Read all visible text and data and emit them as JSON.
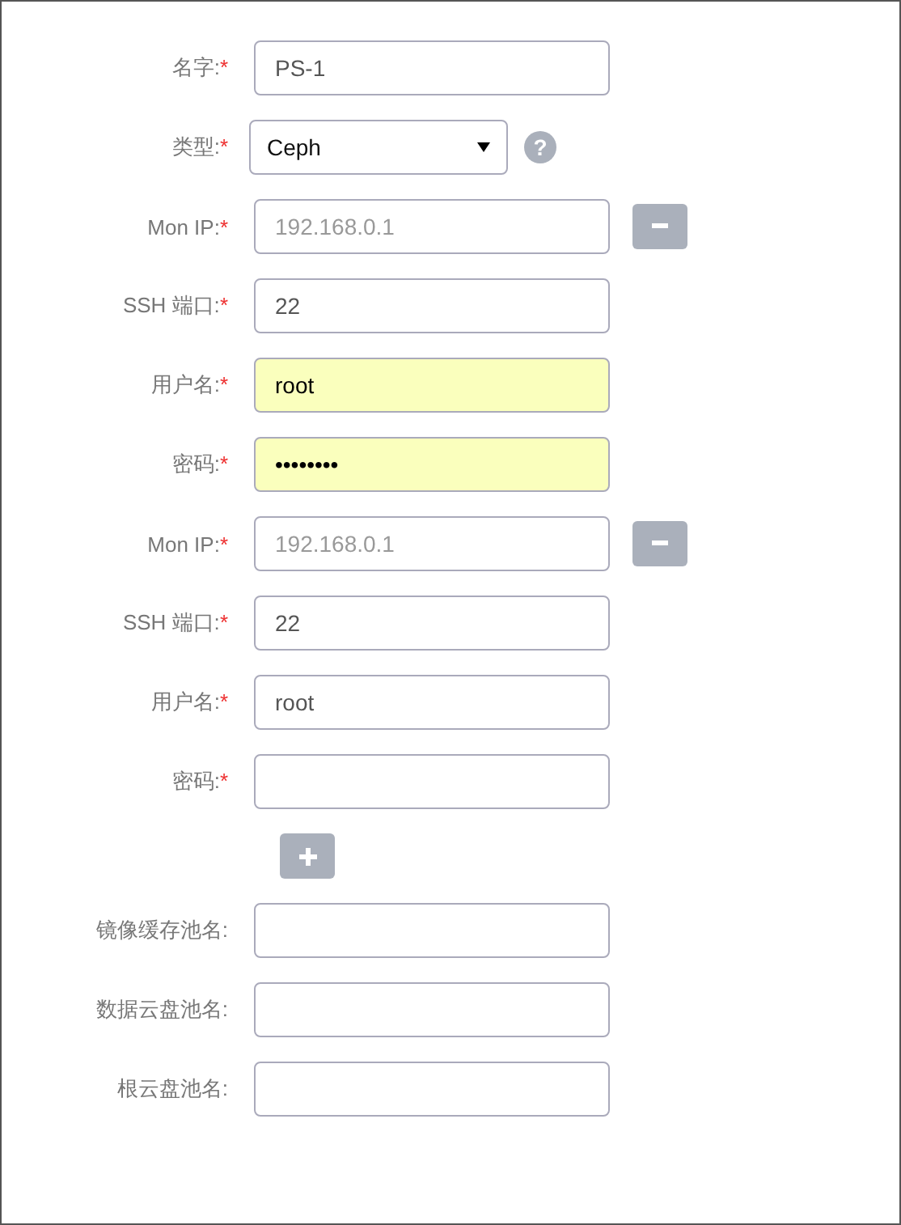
{
  "rows": [
    {
      "kind": "text",
      "label": "名字:",
      "required_mark": "*",
      "value": "PS-1",
      "autofilled": false
    },
    {
      "kind": "select",
      "label": "类型:",
      "required_mark": "*",
      "value": "Ceph",
      "help": "?"
    },
    {
      "kind": "text",
      "label": "Mon IP:",
      "required_mark": "*",
      "placeholder": "192.168.0.1",
      "autofilled": false,
      "removable": true
    },
    {
      "kind": "text",
      "label": "SSH 端口:",
      "required_mark": "*",
      "value": "22",
      "autofilled": false
    },
    {
      "kind": "text",
      "label": "用户名:",
      "required_mark": "*",
      "value": "root",
      "autofilled": true
    },
    {
      "kind": "text",
      "label": "密码:",
      "required_mark": "*",
      "value": "••••••••",
      "autofilled": true
    },
    {
      "kind": "text",
      "label": "Mon IP:",
      "required_mark": "*",
      "placeholder": "192.168.0.1",
      "autofilled": false,
      "removable": true
    },
    {
      "kind": "text",
      "label": "SSH 端口:",
      "required_mark": "*",
      "value": "22",
      "autofilled": false
    },
    {
      "kind": "text",
      "label": "用户名:",
      "required_mark": "*",
      "value": "root",
      "autofilled": false
    },
    {
      "kind": "text",
      "label": "密码:",
      "required_mark": "*",
      "autofilled": false
    },
    {
      "kind": "add"
    },
    {
      "kind": "text",
      "label": "镜像缓存池名:",
      "autofilled": false
    },
    {
      "kind": "text",
      "label": "数据云盘池名:",
      "autofilled": false
    },
    {
      "kind": "text",
      "label": "根云盘池名:",
      "autofilled": false
    }
  ]
}
